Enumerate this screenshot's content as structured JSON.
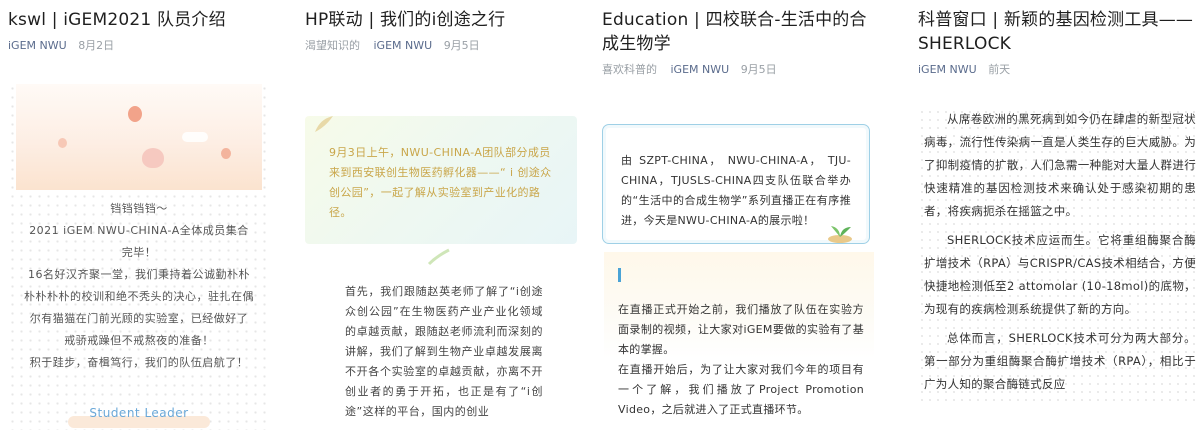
{
  "cards": [
    {
      "title": "kswl | iGEM2021 队员介绍",
      "source": "iGEM NWU",
      "date": "8月2日",
      "lines": [
        "铛铛铛铛～",
        "2021 iGEM NWU-CHINA-A全体成员集合",
        "完毕！",
        "16名好汉齐聚一堂，我们秉持着公诚勤朴朴",
        "朴朴朴朴的校训和绝不秃头的决心，驻扎在偶",
        "尔有猫猫在门前光顾的实验室，已经做好了",
        "戒骄戒躁但不戒熬夜的准备！",
        "积于跬步，奋楫笃行，我们的队伍启航了！"
      ],
      "leader": "Student Leader"
    },
    {
      "title": "HP联动 | 我们的i创途之行",
      "prefix": "渴望知识的",
      "source": "iGEM NWU",
      "date": "9月5日",
      "quote": "9月3日上午，NWU-CHINA-A团队部分成员来到西安联创生物医药孵化器——“ i 创途众创公园”，一起了解从实验室到产业化的路径。",
      "body": "首先，我们跟随赵英老师了解了“i创途众创公园”在生物医药产业产业化领域的卓越贡献，跟随赵老师流利而深刻的讲解，我们了解到生物产业卓越发展离不开各个实验室的卓越贡献，亦离不开创业者的勇于开拓，也正是有了“i创途”这样的平台，国内的创业"
    },
    {
      "title": "Education | 四校联合-生活中的合成生物学",
      "prefix": "喜欢科普的",
      "source": "iGEM NWU",
      "date": "9月5日",
      "box": "由 SZPT-CHINA， NWU-CHINA-A， TJU-CHINA，TJUSLS-CHINA四支队伍联合举办的“生活中的合成生物学”系列直播正在有序推进，今天是NWU-CHINA-A的展示啦！",
      "panel": "在直播正式开始之前，我们播放了队伍在实验方面录制的视频，让大家对iGEM要做的实验有了基本的掌握。\n在直播开始后，为了让大家对我们今年的项目有一个了解，我们播放了Project Promotion Video，之后就进入了正式直播环节。"
    },
    {
      "title": "科普窗口 | 新颖的基因检测工具——SHERLOCK",
      "source": "iGEM NWU",
      "date": "前天",
      "paragraphs": [
        "从席卷欧洲的黑死病到如今仍在肆虐的新型冠状病毒，流行性传染病一直是人类生存的巨大威胁。为了抑制疫情的扩散，人们急需一种能对大量人群进行快速精准的基因检测技术来确认处于感染初期的患者，将疾病扼杀在摇篮之中。",
        "SHERLOCK技术应运而生。它将重组酶聚合酶扩增技术（RPA）与CRISPR/CAS技术相结合，方便快捷地检测低至2 attomolar (10-18mol)的底物，为现有的疾病检测系统提供了新的方向。",
        "总体而言，SHERLOCK技术可分为两大部分。第一部分为重组酶聚合酶扩增技术（RPA），相比于广为人知的聚合酶链式反应"
      ]
    }
  ]
}
